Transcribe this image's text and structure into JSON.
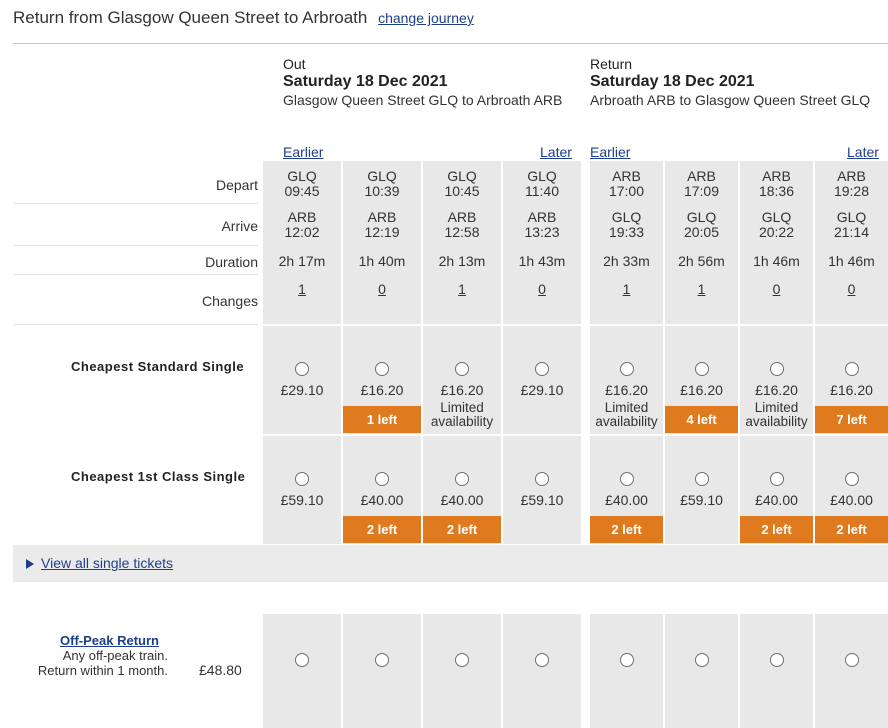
{
  "page": {
    "title": "Return from Glasgow Queen Street to Arbroath",
    "change_link": "change journey"
  },
  "out": {
    "label": "Out",
    "date": "Saturday 18 Dec 2021",
    "route": "Glasgow Queen Street GLQ to Arbroath ARB",
    "earlier": "Earlier",
    "later": "Later",
    "trains": [
      {
        "depart_station": "GLQ",
        "depart_time": "09:45",
        "arrive_station": "ARB",
        "arrive_time": "12:02",
        "duration": "2h 17m",
        "changes": "1"
      },
      {
        "depart_station": "GLQ",
        "depart_time": "10:39",
        "arrive_station": "ARB",
        "arrive_time": "12:19",
        "duration": "1h 40m",
        "changes": "0"
      },
      {
        "depart_station": "GLQ",
        "depart_time": "10:45",
        "arrive_station": "ARB",
        "arrive_time": "12:58",
        "duration": "2h 13m",
        "changes": "1"
      },
      {
        "depart_station": "GLQ",
        "depart_time": "11:40",
        "arrive_station": "ARB",
        "arrive_time": "13:23",
        "duration": "1h 43m",
        "changes": "0"
      }
    ]
  },
  "ret": {
    "label": "Return",
    "date": "Saturday 18 Dec 2021",
    "route": "Arbroath ARB to Glasgow Queen Street GLQ",
    "earlier": "Earlier",
    "later": "Later",
    "trains": [
      {
        "depart_station": "ARB",
        "depart_time": "17:00",
        "arrive_station": "GLQ",
        "arrive_time": "19:33",
        "duration": "2h 33m",
        "changes": "1"
      },
      {
        "depart_station": "ARB",
        "depart_time": "17:09",
        "arrive_station": "GLQ",
        "arrive_time": "20:05",
        "duration": "2h 56m",
        "changes": "1"
      },
      {
        "depart_station": "ARB",
        "depart_time": "18:36",
        "arrive_station": "GLQ",
        "arrive_time": "20:22",
        "duration": "1h 46m",
        "changes": "0"
      },
      {
        "depart_station": "ARB",
        "depart_time": "19:28",
        "arrive_station": "GLQ",
        "arrive_time": "21:14",
        "duration": "1h 46m",
        "changes": "0"
      }
    ]
  },
  "row_labels": {
    "depart": "Depart",
    "arrive": "Arrive",
    "duration": "Duration",
    "changes": "Changes"
  },
  "fares": {
    "standard": {
      "label": "Cheapest Standard Single",
      "prices": [
        "£29.10",
        "£16.20",
        "£16.20",
        "£29.10",
        "£16.20",
        "£16.20",
        "£16.20",
        "£16.20"
      ],
      "avail_text": [
        "",
        "",
        "Limited availability",
        "",
        "Limited availability",
        "",
        "Limited availability",
        ""
      ],
      "badges": [
        "",
        "1 left",
        "",
        "",
        "",
        "4 left",
        "",
        "7 left"
      ]
    },
    "first": {
      "label": "Cheapest 1st Class Single",
      "prices": [
        "£59.10",
        "£40.00",
        "£40.00",
        "£59.10",
        "£40.00",
        "£59.10",
        "£40.00",
        "£40.00"
      ],
      "badges": [
        "",
        "2 left",
        "2 left",
        "",
        "2 left",
        "",
        "2 left",
        "2 left"
      ]
    }
  },
  "view_all": "View all single tickets",
  "return_fare": {
    "name": "Off-Peak Return",
    "desc_line1": "Any off-peak train.",
    "desc_line2": "Return within 1 month.",
    "price": "£48.80"
  },
  "colors": {
    "badge": "#e07a1f",
    "link": "#1d3f8a",
    "column_bg": "#e8e8e8"
  }
}
